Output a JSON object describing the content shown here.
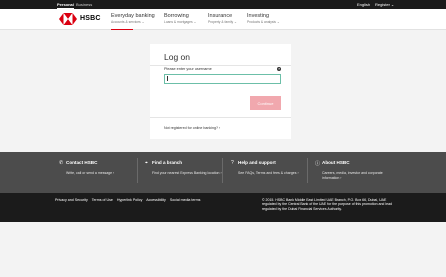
{
  "topbar": {
    "personal": "Personal",
    "business": "Business",
    "language": "English",
    "register": "Register"
  },
  "header": {
    "brand": "HSBC",
    "nav": [
      {
        "title": "Everyday banking",
        "subtitle": "Accounts & services"
      },
      {
        "title": "Borrowing",
        "subtitle": "Loans & mortgages"
      },
      {
        "title": "Insurance",
        "subtitle": "Property & family"
      },
      {
        "title": "Investing",
        "subtitle": "Products & analysis"
      }
    ]
  },
  "login": {
    "title": "Log on",
    "field_label": "Please enter your username",
    "help_icon": "?",
    "username_value": "",
    "continue_label": "Continue",
    "not_registered": "Not registered for online banking?"
  },
  "footer": {
    "columns": [
      {
        "icon": "phone-icon",
        "heading": "Contact HSBC",
        "desc": "Write, call or send a message"
      },
      {
        "icon": "location-pin-icon",
        "heading": "Find a branch",
        "desc": "Find your nearest Express Banking location"
      },
      {
        "icon": "help-icon",
        "heading": "Help and support",
        "desc": "See FAQs, Terms and fees & charges"
      },
      {
        "icon": "info-icon",
        "heading": "About HSBC",
        "desc": "Careers, media, investor and corporate information"
      }
    ],
    "links": [
      "Privacy and Security",
      "Terms of Use",
      "Hyperlink Policy",
      "Accessibility",
      "Social media terms"
    ],
    "copyright": "© 2015. HSBC Bank Middle East Limited UAE Branch, P.O. Box 66, Dubai, UAE regulated by the Central Bank of the UAE for the purpose of this promotion and lead regulated by the Dubai Financial Services Authority."
  },
  "colors": {
    "brand_red": "#db0011",
    "continue_disabled": "#f1a8ae",
    "footer_grey": "#4c4c4c",
    "footer_black": "#1b1b1b"
  }
}
